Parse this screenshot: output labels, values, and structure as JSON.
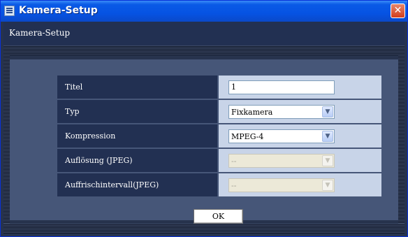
{
  "window": {
    "title": "Kamera-Setup",
    "close_glyph": "✕"
  },
  "header": {
    "text": "Kamera-Setup"
  },
  "form": {
    "rows": [
      {
        "label": "Titel",
        "control": "text",
        "value": "1"
      },
      {
        "label": "Typ",
        "control": "select",
        "value": "Fixkamera",
        "enabled": true
      },
      {
        "label": "Kompression",
        "control": "select",
        "value": "MPEG-4",
        "enabled": true
      },
      {
        "label": "Auflösung (JPEG)",
        "control": "select",
        "value": "--",
        "enabled": false
      },
      {
        "label": "Auffrischintervall(JPEG)",
        "control": "select",
        "value": "--",
        "enabled": false
      }
    ],
    "ok_label": "OK"
  },
  "icons": {
    "dropdown": "chevron-down-icon",
    "window": "window-icon",
    "close": "close-icon"
  },
  "colors": {
    "titlebar": "#0653e3",
    "background": "#27334d",
    "label_cell": "#223052",
    "value_cell": "#c8d4e8"
  }
}
